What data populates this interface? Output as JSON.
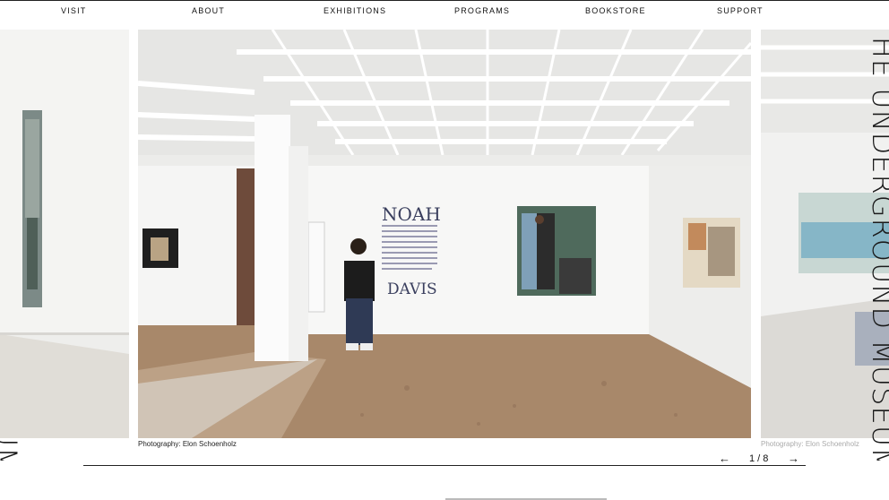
{
  "nav": {
    "items": [
      {
        "label": "VISIT"
      },
      {
        "label": "ABOUT"
      },
      {
        "label": "EXHIBITIONS"
      },
      {
        "label": "PROGRAMS"
      },
      {
        "label": "BOOKSTORE"
      },
      {
        "label": "SUPPORT"
      }
    ]
  },
  "wordmark": "THE UNDERGROUND MUSEUM",
  "gallery": {
    "main_caption": "Photography: Elon Schoenholz",
    "next_caption": "Photography: Elon Schoenholz",
    "exhibition_title_top": "NOAH",
    "exhibition_title_bottom": "DAVIS",
    "pagination": "1 / 8",
    "prev_arrow": "←",
    "next_arrow": "→"
  }
}
